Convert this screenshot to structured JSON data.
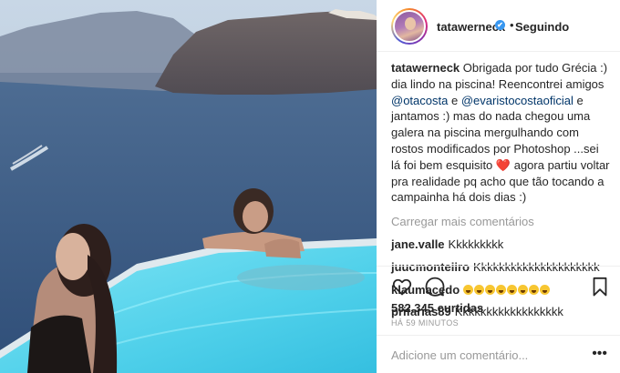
{
  "post": {
    "author": "tatawerneck",
    "follow_status": "Seguindo",
    "follow_dot": "•",
    "verified_mark": "✔",
    "avatar_icon": "profile-avatar",
    "photo_icon": "post-photo"
  },
  "caption": {
    "username": "tatawerneck",
    "part1": "Obrigada por tudo Grécia :) dia lindo na piscina! Reencontrei amigos",
    "mention1": "@otacosta",
    "part2": "e",
    "mention2": "@evaristocostaoficial",
    "part3": "e jantamos :) mas do nada chegou uma galera na piscina mergulhando com rostos modificados por Photoshop ...sei lá foi bem esquisito",
    "heart": "❤️",
    "part4": "agora partiu voltar pra realidade pq acho que tão tocando a campainha há dois dias :)"
  },
  "load_more": "Carregar mais comentários",
  "comments": [
    {
      "username": "jane.valle",
      "text": "Kkkkkkkkk"
    },
    {
      "username": "juucmonteiiro",
      "text": "Kkkkkkkkkkkkkkkkkkkkk"
    },
    {
      "username": "klaumacedo",
      "emoji_count": 8
    },
    {
      "username": "prifarias89",
      "text": "Kkkkkkkkkkkkkkkkkk"
    }
  ],
  "actions": {
    "like_icon": "heart-outline",
    "comment_icon": "speech-bubble",
    "save_icon": "bookmark"
  },
  "likes": "582.345 curtidas",
  "time": "HÁ 59 MINUTOS",
  "add_comment": {
    "placeholder": "Adicione um comentário...",
    "more": "•••"
  },
  "colors": {
    "link": "#003569",
    "verified": "#3897f0",
    "heart": "#ed4956",
    "muted": "#999999"
  }
}
